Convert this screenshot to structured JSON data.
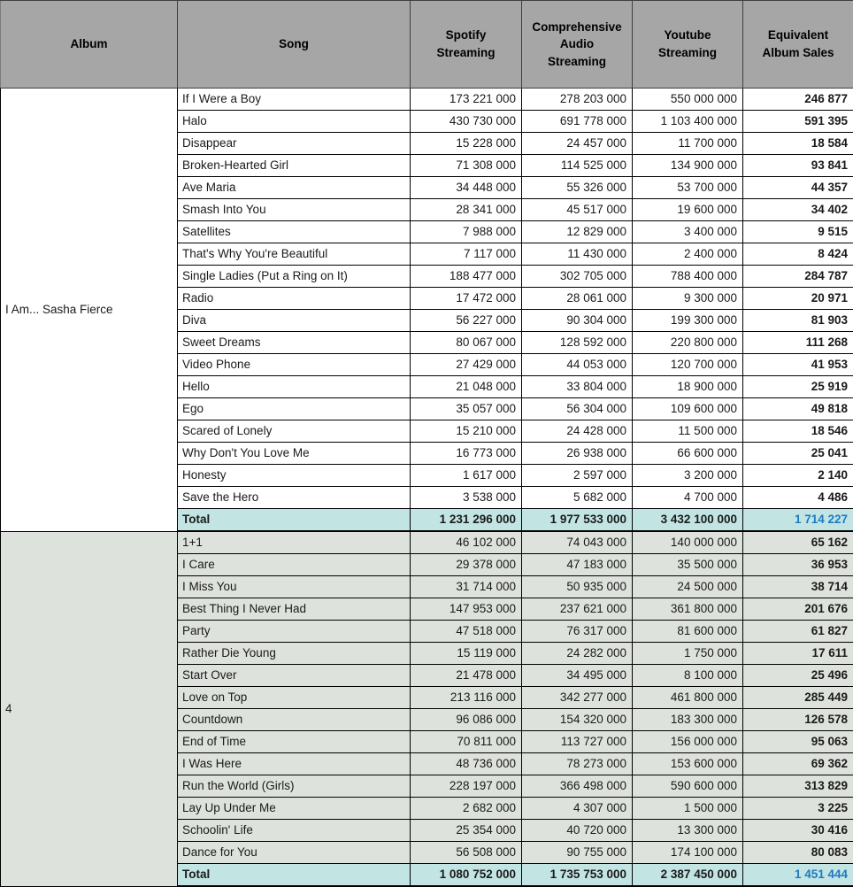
{
  "table": {
    "columns": [
      {
        "key": "album",
        "label": "Album"
      },
      {
        "key": "song",
        "label": "Song"
      },
      {
        "key": "spotify",
        "label": "Spotify Streaming"
      },
      {
        "key": "cas",
        "label": "Comprehensive Audio Streaming"
      },
      {
        "key": "youtube",
        "label": "Youtube Streaming"
      },
      {
        "key": "eas",
        "label": "Equivalent Album Sales"
      }
    ],
    "header": {
      "album": "Album",
      "song": "Song",
      "spotify_line1": "Spotify",
      "spotify_line2": "Streaming",
      "cas_line1": "Comprehensive",
      "cas_line2": "Audio",
      "cas_line3": "Streaming",
      "youtube_line1": "Youtube",
      "youtube_line2": "Streaming",
      "eas_line1": "Equivalent",
      "eas_line2": "Album Sales"
    },
    "total_label": "Total",
    "colors": {
      "header_bg": "#a6a6a6",
      "section_a_bg": "#ffffff",
      "section_b_bg": "#dee2dc",
      "total_bg": "#c2e5e3",
      "total_eas_text": "#1f7ac1",
      "grid_line": "#000000"
    },
    "sections": [
      {
        "album": "I Am... Sasha Fierce",
        "rows": [
          {
            "song": "If I Were a Boy",
            "spotify": "173 221 000",
            "cas": "278 203 000",
            "youtube": "550 000 000",
            "eas": "246 877"
          },
          {
            "song": "Halo",
            "spotify": "430 730 000",
            "cas": "691 778 000",
            "youtube": "1 103 400 000",
            "eas": "591 395"
          },
          {
            "song": "Disappear",
            "spotify": "15 228 000",
            "cas": "24 457 000",
            "youtube": "11 700 000",
            "eas": "18 584"
          },
          {
            "song": "Broken-Hearted Girl",
            "spotify": "71 308 000",
            "cas": "114 525 000",
            "youtube": "134 900 000",
            "eas": "93 841"
          },
          {
            "song": "Ave Maria",
            "spotify": "34 448 000",
            "cas": "55 326 000",
            "youtube": "53 700 000",
            "eas": "44 357"
          },
          {
            "song": "Smash Into You",
            "spotify": "28 341 000",
            "cas": "45 517 000",
            "youtube": "19 600 000",
            "eas": "34 402"
          },
          {
            "song": "Satellites",
            "spotify": "7 988 000",
            "cas": "12 829 000",
            "youtube": "3 400 000",
            "eas": "9 515"
          },
          {
            "song": "That's Why You're Beautiful",
            "spotify": "7 117 000",
            "cas": "11 430 000",
            "youtube": "2 400 000",
            "eas": "8 424"
          },
          {
            "song": "Single Ladies (Put a Ring on It)",
            "spotify": "188 477 000",
            "cas": "302 705 000",
            "youtube": "788 400 000",
            "eas": "284 787"
          },
          {
            "song": "Radio",
            "spotify": "17 472 000",
            "cas": "28 061 000",
            "youtube": "9 300 000",
            "eas": "20 971"
          },
          {
            "song": "Diva",
            "spotify": "56 227 000",
            "cas": "90 304 000",
            "youtube": "199 300 000",
            "eas": "81 903"
          },
          {
            "song": "Sweet Dreams",
            "spotify": "80 067 000",
            "cas": "128 592 000",
            "youtube": "220 800 000",
            "eas": "111 268"
          },
          {
            "song": "Video Phone",
            "spotify": "27 429 000",
            "cas": "44 053 000",
            "youtube": "120 700 000",
            "eas": "41 953"
          },
          {
            "song": "Hello",
            "spotify": "21 048 000",
            "cas": "33 804 000",
            "youtube": "18 900 000",
            "eas": "25 919"
          },
          {
            "song": "Ego",
            "spotify": "35 057 000",
            "cas": "56 304 000",
            "youtube": "109 600 000",
            "eas": "49 818"
          },
          {
            "song": "Scared of Lonely",
            "spotify": "15 210 000",
            "cas": "24 428 000",
            "youtube": "11 500 000",
            "eas": "18 546"
          },
          {
            "song": "Why Don't You Love Me",
            "spotify": "16 773 000",
            "cas": "26 938 000",
            "youtube": "66 600 000",
            "eas": "25 041"
          },
          {
            "song": "Honesty",
            "spotify": "1 617 000",
            "cas": "2 597 000",
            "youtube": "3 200 000",
            "eas": "2 140"
          },
          {
            "song": "Save the Hero",
            "spotify": "3 538 000",
            "cas": "5 682 000",
            "youtube": "4 700 000",
            "eas": "4 486"
          }
        ],
        "total": {
          "song": "Total",
          "spotify": "1 231 296 000",
          "cas": "1 977 533 000",
          "youtube": "3 432 100 000",
          "eas": "1 714 227"
        }
      },
      {
        "album": "4",
        "rows": [
          {
            "song": "1+1",
            "spotify": "46 102 000",
            "cas": "74 043 000",
            "youtube": "140 000 000",
            "eas": "65 162"
          },
          {
            "song": "I Care",
            "spotify": "29 378 000",
            "cas": "47 183 000",
            "youtube": "35 500 000",
            "eas": "36 953"
          },
          {
            "song": "I Miss You",
            "spotify": "31 714 000",
            "cas": "50 935 000",
            "youtube": "24 500 000",
            "eas": "38 714"
          },
          {
            "song": "Best Thing I Never Had",
            "spotify": "147 953 000",
            "cas": "237 621 000",
            "youtube": "361 800 000",
            "eas": "201 676"
          },
          {
            "song": "Party",
            "spotify": "47 518 000",
            "cas": "76 317 000",
            "youtube": "81 600 000",
            "eas": "61 827"
          },
          {
            "song": "Rather Die Young",
            "spotify": "15 119 000",
            "cas": "24 282 000",
            "youtube": "1 750 000",
            "eas": "17 611"
          },
          {
            "song": "Start Over",
            "spotify": "21 478 000",
            "cas": "34 495 000",
            "youtube": "8 100 000",
            "eas": "25 496"
          },
          {
            "song": "Love on Top",
            "spotify": "213 116 000",
            "cas": "342 277 000",
            "youtube": "461 800 000",
            "eas": "285 449"
          },
          {
            "song": "Countdown",
            "spotify": "96 086 000",
            "cas": "154 320 000",
            "youtube": "183 300 000",
            "eas": "126 578"
          },
          {
            "song": "End of Time",
            "spotify": "70 811 000",
            "cas": "113 727 000",
            "youtube": "156 000 000",
            "eas": "95 063"
          },
          {
            "song": "I Was Here",
            "spotify": "48 736 000",
            "cas": "78 273 000",
            "youtube": "153 600 000",
            "eas": "69 362"
          },
          {
            "song": "Run the World (Girls)",
            "spotify": "228 197 000",
            "cas": "366 498 000",
            "youtube": "590 600 000",
            "eas": "313 829"
          },
          {
            "song": "Lay Up Under Me",
            "spotify": "2 682 000",
            "cas": "4 307 000",
            "youtube": "1 500 000",
            "eas": "3 225"
          },
          {
            "song": "Schoolin' Life",
            "spotify": "25 354 000",
            "cas": "40 720 000",
            "youtube": "13 300 000",
            "eas": "30 416"
          },
          {
            "song": "Dance for You",
            "spotify": "56 508 000",
            "cas": "90 755 000",
            "youtube": "174 100 000",
            "eas": "80 083"
          }
        ],
        "total": {
          "song": "Total",
          "spotify": "1 080 752 000",
          "cas": "1 735 753 000",
          "youtube": "2 387 450 000",
          "eas": "1 451 444"
        }
      }
    ]
  }
}
